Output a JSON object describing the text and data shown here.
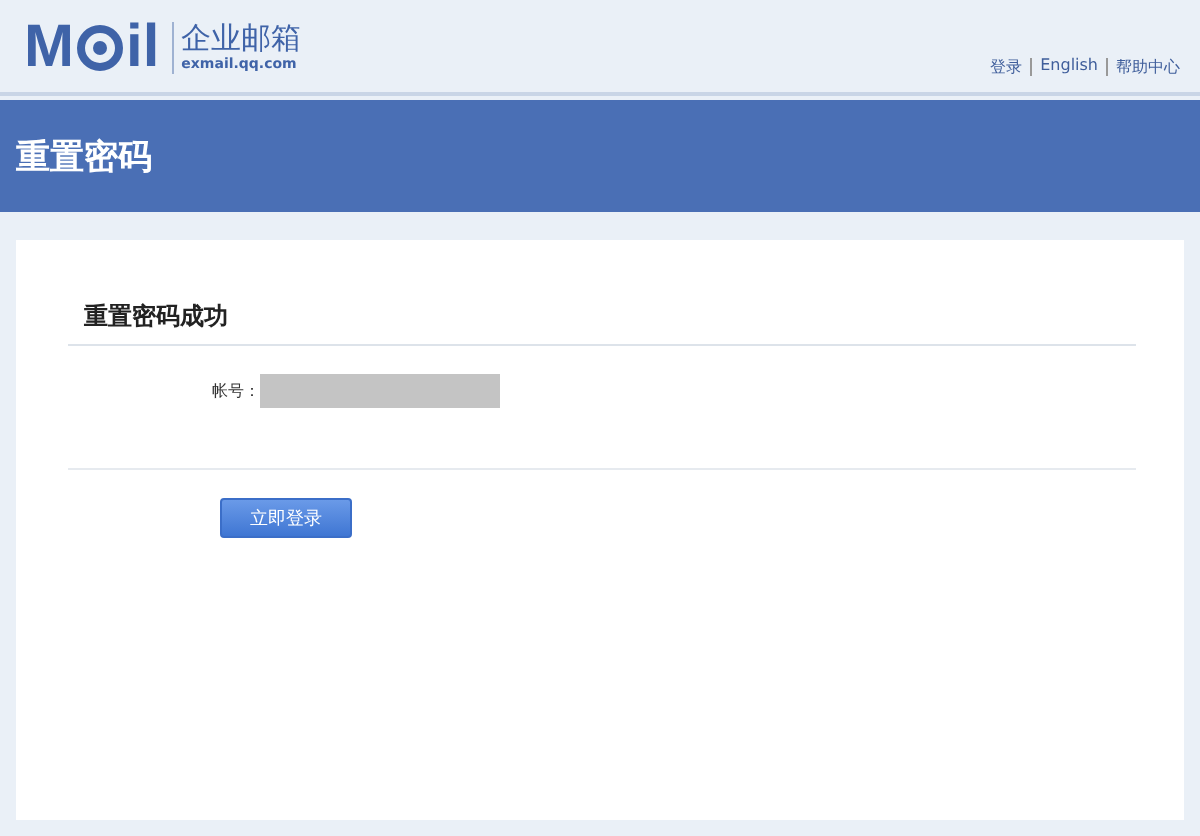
{
  "header": {
    "logo": {
      "left": "M",
      "right": "il",
      "name": "企业邮箱",
      "domain": "exmail.qq.com"
    },
    "links": [
      "登录",
      "English",
      "帮助中心"
    ]
  },
  "banner": {
    "title": "重置密码"
  },
  "panel": {
    "heading": "重置密码成功",
    "account_label": "帐号：",
    "button": "立即登录"
  }
}
